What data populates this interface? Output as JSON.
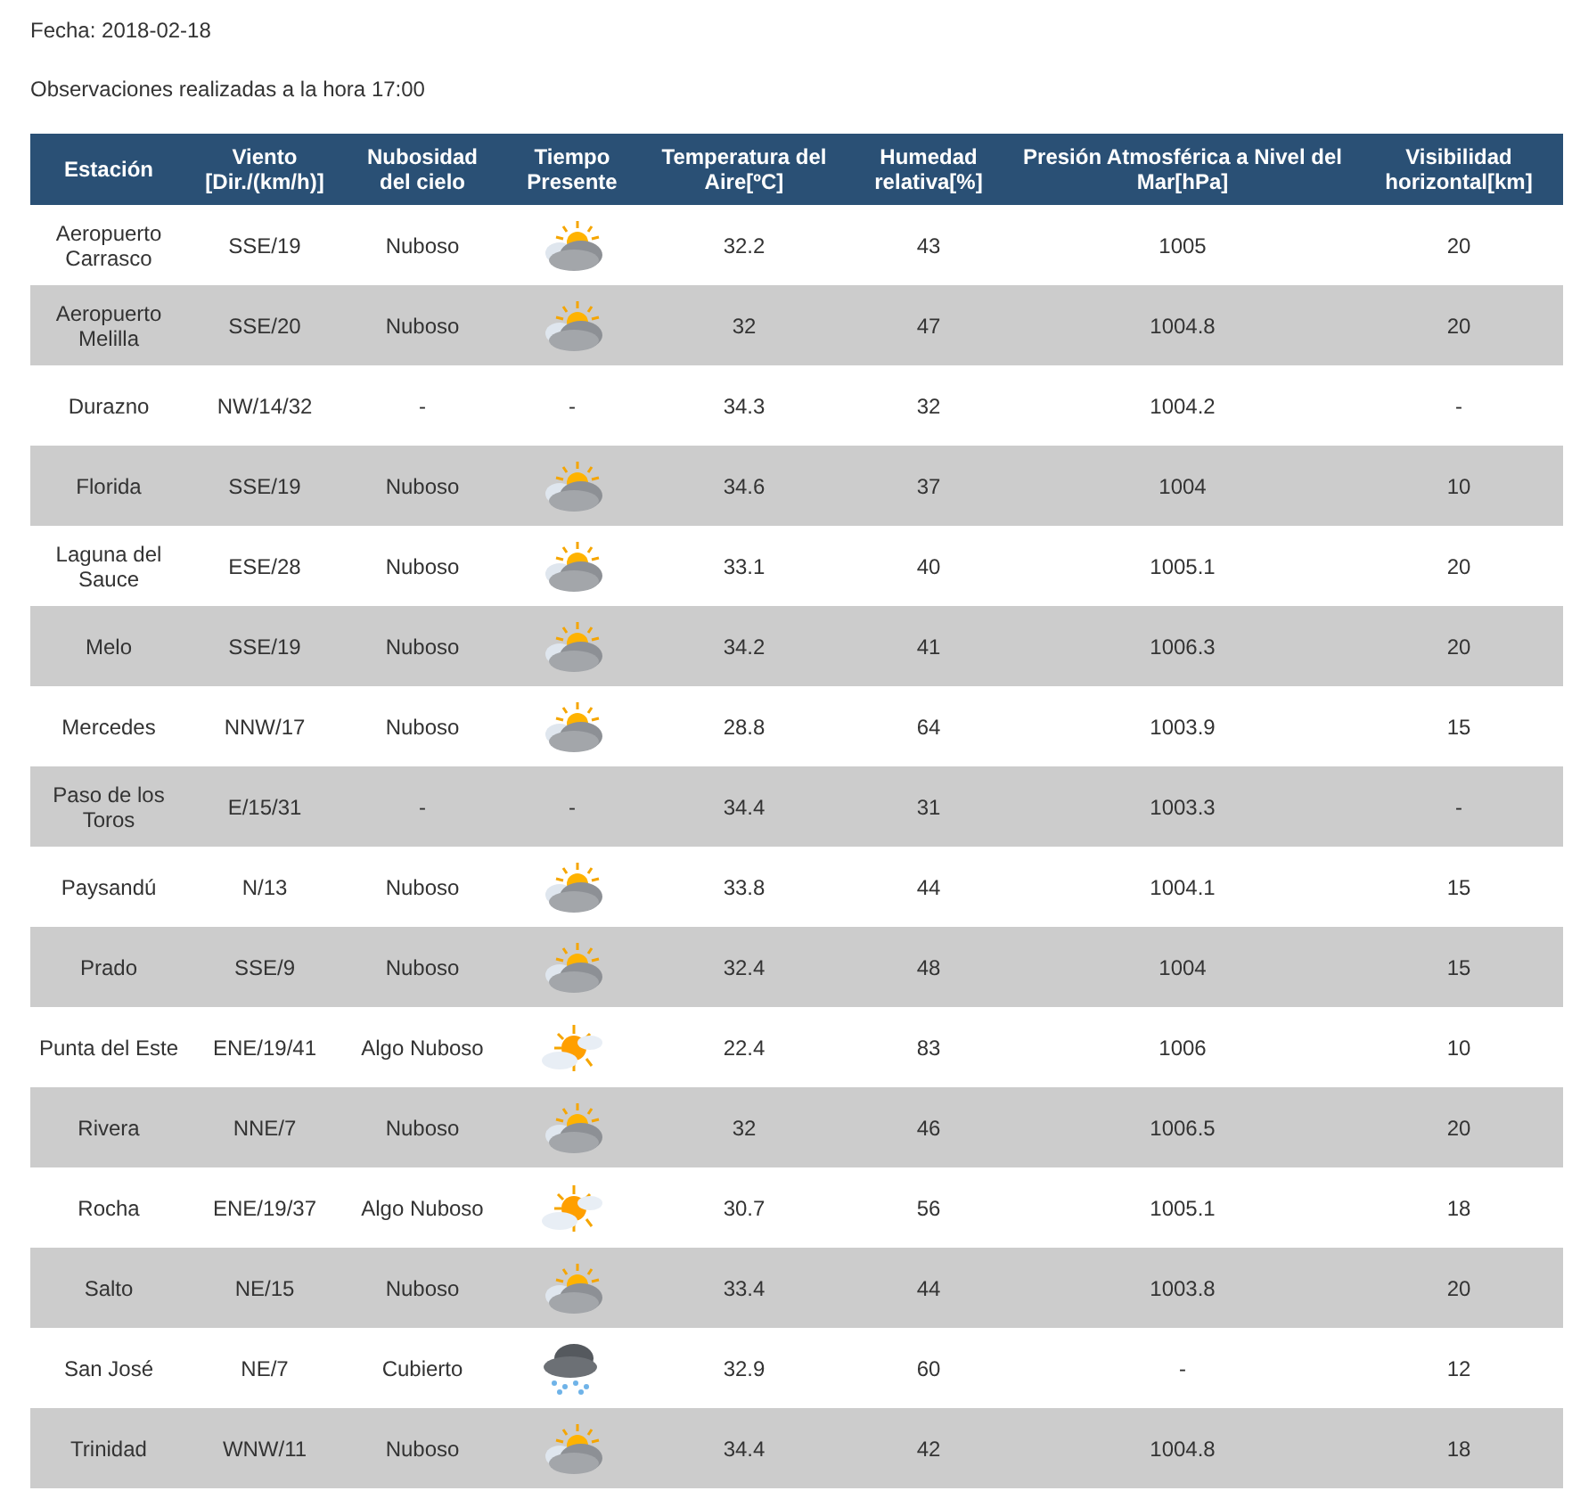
{
  "fecha": "Fecha: 2018-02-18",
  "observaciones": "Observaciones realizadas a la hora 17:00",
  "table": {
    "columns": [
      "Estación",
      "Viento [Dir./(km/h)]",
      "Nubosidad del cielo",
      "Tiempo Presente",
      "Temperatura del Aire[ºC]",
      "Humedad relativa[%]",
      "Presión Atmosférica a Nivel del Mar[hPa]",
      "Visibilidad horizontal[km]"
    ],
    "rows": [
      {
        "estacion": "Aeropuerto Carrasco",
        "viento": "SSE/19",
        "nubosidad": "Nuboso",
        "tiempo": {
          "kind": "cloudy"
        },
        "temperatura": "32.2",
        "humedad": "43",
        "presion": "1005",
        "visibilidad": "20"
      },
      {
        "estacion": "Aeropuerto Melilla",
        "viento": "SSE/20",
        "nubosidad": "Nuboso",
        "tiempo": {
          "kind": "cloudy"
        },
        "temperatura": "32",
        "humedad": "47",
        "presion": "1004.8",
        "visibilidad": "20"
      },
      {
        "estacion": "Durazno",
        "viento": "NW/14/32",
        "nubosidad": "-",
        "tiempo": {
          "kind": "text",
          "text": "-"
        },
        "temperatura": "34.3",
        "humedad": "32",
        "presion": "1004.2",
        "visibilidad": "-"
      },
      {
        "estacion": "Florida",
        "viento": "SSE/19",
        "nubosidad": "Nuboso",
        "tiempo": {
          "kind": "cloudy"
        },
        "temperatura": "34.6",
        "humedad": "37",
        "presion": "1004",
        "visibilidad": "10"
      },
      {
        "estacion": "Laguna del Sauce",
        "viento": "ESE/28",
        "nubosidad": "Nuboso",
        "tiempo": {
          "kind": "cloudy"
        },
        "temperatura": "33.1",
        "humedad": "40",
        "presion": "1005.1",
        "visibilidad": "20"
      },
      {
        "estacion": "Melo",
        "viento": "SSE/19",
        "nubosidad": "Nuboso",
        "tiempo": {
          "kind": "cloudy"
        },
        "temperatura": "34.2",
        "humedad": "41",
        "presion": "1006.3",
        "visibilidad": "20"
      },
      {
        "estacion": "Mercedes",
        "viento": "NNW/17",
        "nubosidad": "Nuboso",
        "tiempo": {
          "kind": "cloudy"
        },
        "temperatura": "28.8",
        "humedad": "64",
        "presion": "1003.9",
        "visibilidad": "15"
      },
      {
        "estacion": "Paso de los Toros",
        "viento": "E/15/31",
        "nubosidad": "-",
        "tiempo": {
          "kind": "text",
          "text": "-"
        },
        "temperatura": "34.4",
        "humedad": "31",
        "presion": "1003.3",
        "visibilidad": "-"
      },
      {
        "estacion": "Paysandú",
        "viento": "N/13",
        "nubosidad": "Nuboso",
        "tiempo": {
          "kind": "cloudy"
        },
        "temperatura": "33.8",
        "humedad": "44",
        "presion": "1004.1",
        "visibilidad": "15"
      },
      {
        "estacion": "Prado",
        "viento": "SSE/9",
        "nubosidad": "Nuboso",
        "tiempo": {
          "kind": "cloudy"
        },
        "temperatura": "32.4",
        "humedad": "48",
        "presion": "1004",
        "visibilidad": "15"
      },
      {
        "estacion": "Punta del Este",
        "viento": "ENE/19/41",
        "nubosidad": "Algo Nuboso",
        "tiempo": {
          "kind": "partly"
        },
        "temperatura": "22.4",
        "humedad": "83",
        "presion": "1006",
        "visibilidad": "10"
      },
      {
        "estacion": "Rivera",
        "viento": "NNE/7",
        "nubosidad": "Nuboso",
        "tiempo": {
          "kind": "cloudy"
        },
        "temperatura": "32",
        "humedad": "46",
        "presion": "1006.5",
        "visibilidad": "20"
      },
      {
        "estacion": "Rocha",
        "viento": "ENE/19/37",
        "nubosidad": "Algo Nuboso",
        "tiempo": {
          "kind": "partly"
        },
        "temperatura": "30.7",
        "humedad": "56",
        "presion": "1005.1",
        "visibilidad": "18"
      },
      {
        "estacion": "Salto",
        "viento": "NE/15",
        "nubosidad": "Nuboso",
        "tiempo": {
          "kind": "cloudy"
        },
        "temperatura": "33.4",
        "humedad": "44",
        "presion": "1003.8",
        "visibilidad": "20"
      },
      {
        "estacion": "San José",
        "viento": "NE/7",
        "nubosidad": "Cubierto",
        "tiempo": {
          "kind": "showers"
        },
        "temperatura": "32.9",
        "humedad": "60",
        "presion": "-",
        "visibilidad": "12"
      },
      {
        "estacion": "Trinidad",
        "viento": "WNW/11",
        "nubosidad": "Nuboso",
        "tiempo": {
          "kind": "cloudy"
        },
        "temperatura": "34.4",
        "humedad": "42",
        "presion": "1004.8",
        "visibilidad": "18"
      }
    ]
  }
}
